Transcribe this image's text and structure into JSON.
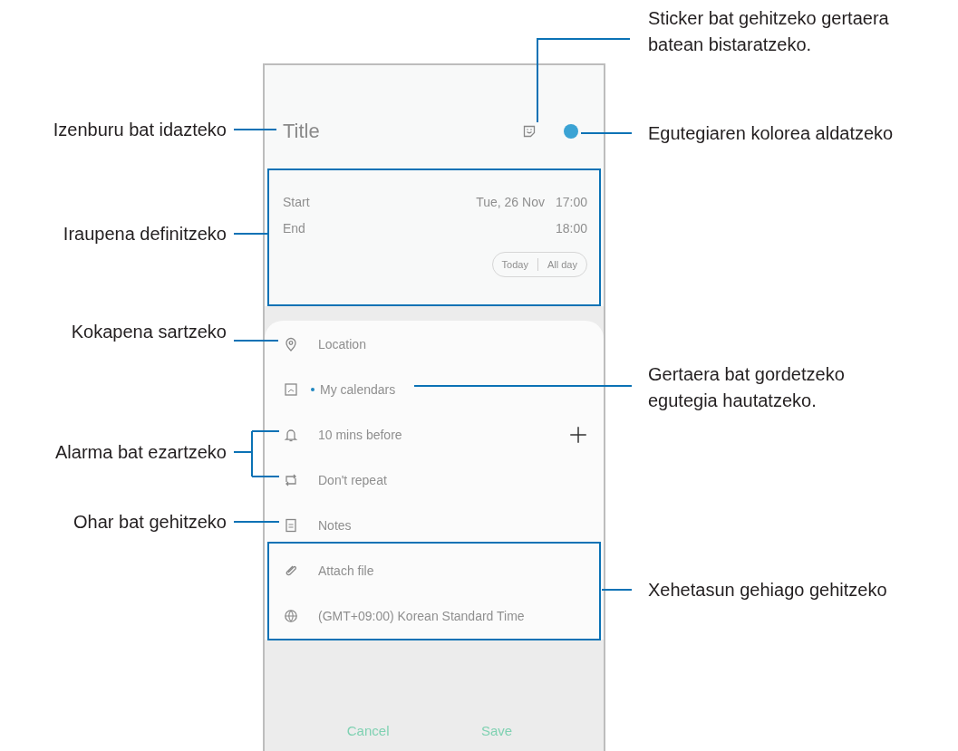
{
  "phone": {
    "title": "Title",
    "start": {
      "label": "Start",
      "date": "Tue, 26 Nov",
      "time": "17:00"
    },
    "end": {
      "label": "End",
      "time": "18:00"
    },
    "toggle": [
      "Today",
      "All day"
    ],
    "rows": [
      {
        "kind": "location",
        "text": "Location"
      },
      {
        "kind": "calendar",
        "text": "My calendars"
      },
      {
        "kind": "alarm",
        "text": "10 mins before"
      },
      {
        "kind": "repeat",
        "text": "Don't repeat"
      },
      {
        "kind": "notes",
        "text": "Notes"
      },
      {
        "kind": "attach",
        "text": "Attach file"
      },
      {
        "kind": "timezone",
        "text": "(GMT+09:00) Korean Standard Time"
      }
    ],
    "buttons": [
      "Cancel",
      "Save"
    ]
  },
  "callouts": [
    {
      "kind": "left",
      "text": "Izenburu bat idazteko"
    },
    {
      "kind": "left",
      "text": "Iraupena definitzeko"
    },
    {
      "kind": "left",
      "text": "Kokapena sartzeko"
    },
    {
      "kind": "left",
      "text": "Alarma bat ezartzeko"
    },
    {
      "kind": "left",
      "text": "Ohar bat gehitzeko"
    },
    {
      "kind": "right",
      "text": "Sticker bat gehitzeko gertaera batean bistaratzeko."
    },
    {
      "kind": "right",
      "text": "Egutegiaren kolorea aldatzeko"
    },
    {
      "kind": "right",
      "text": "Gertaera bat gordetzeko egutegia hautatzeko."
    },
    {
      "kind": "right",
      "text": "Xehetasun gehiago gehitzeko"
    }
  ]
}
